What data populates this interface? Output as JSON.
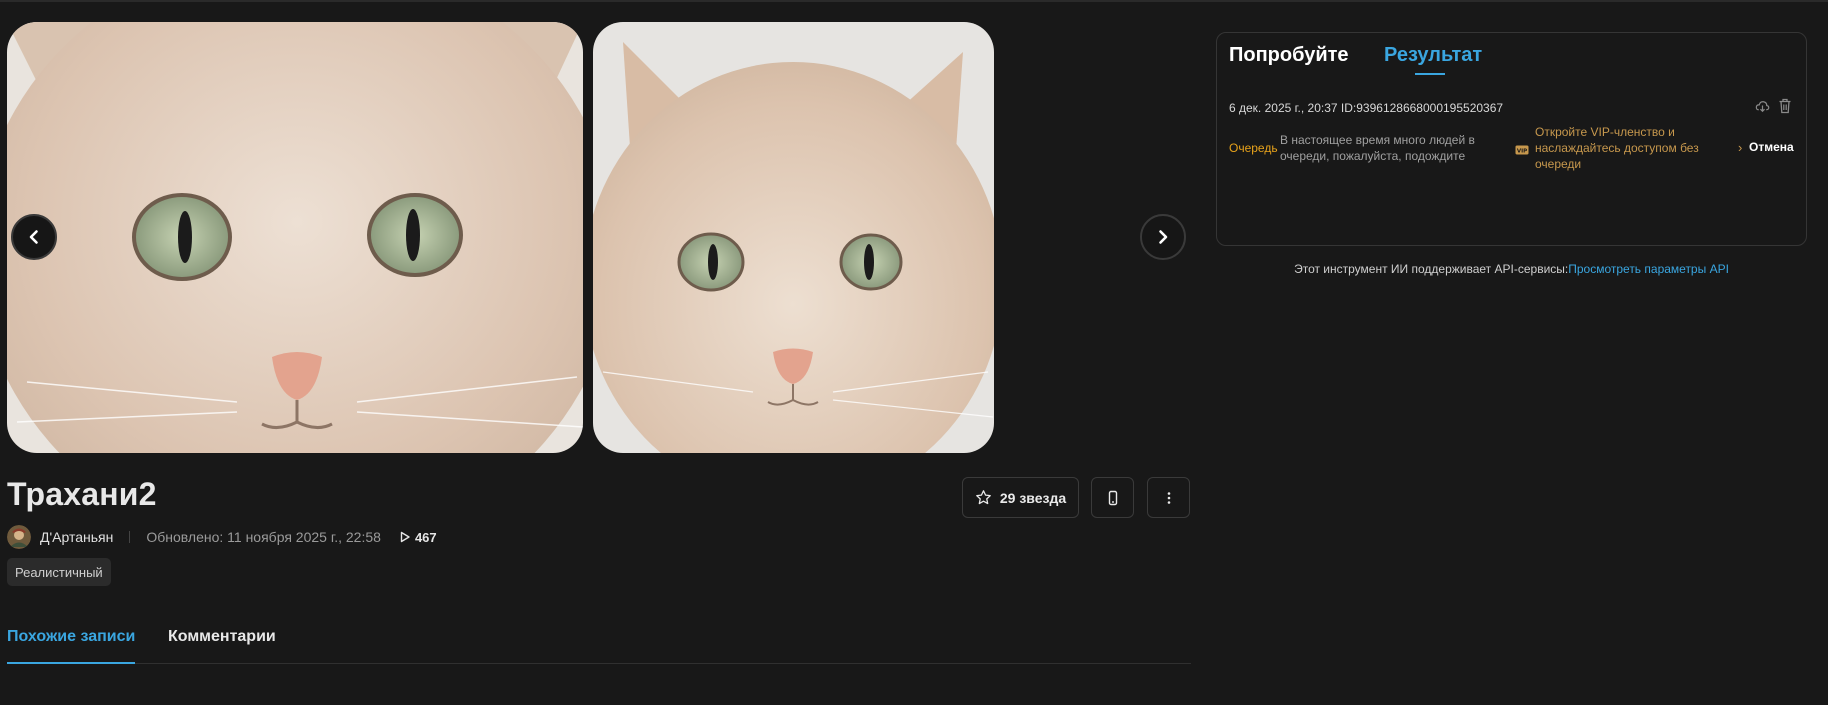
{
  "item": {
    "title": "Трахани2",
    "author": "Д'Артаньян",
    "updated": "Обновлено: 11 ноября 2025 г., 22:58",
    "plays": "467",
    "tag": "Реалистичный",
    "stars_count": "29",
    "stars_label": "звезда"
  },
  "gallery": {
    "images": [
      "cat-photo-closeup",
      "cat-photo-portrait"
    ]
  },
  "tabs": {
    "similar": "Похожие записи",
    "comments": "Комментарии"
  },
  "panel": {
    "tab_try": "Попробуйте",
    "tab_result": "Результат",
    "job_line": "6 дек. 2025 г., 20:37 ID:939612866800019552036​7",
    "queue_label": "Очередь",
    "queue_message": "В настоящее время много людей в очереди, пожалуйста, подождите",
    "vip_message": "Откройте VIP-членство и наслаждайтесь доступом без очереди",
    "cancel": "Отмена"
  },
  "api": {
    "text": "Этот инструмент ИИ поддерживает API-сервисы:",
    "link": "Просмотреть параметры API"
  },
  "colors": {
    "background": "#181818",
    "accent": "#3aa6e0",
    "queue": "#e8a31b",
    "vip": "#c7984d"
  }
}
